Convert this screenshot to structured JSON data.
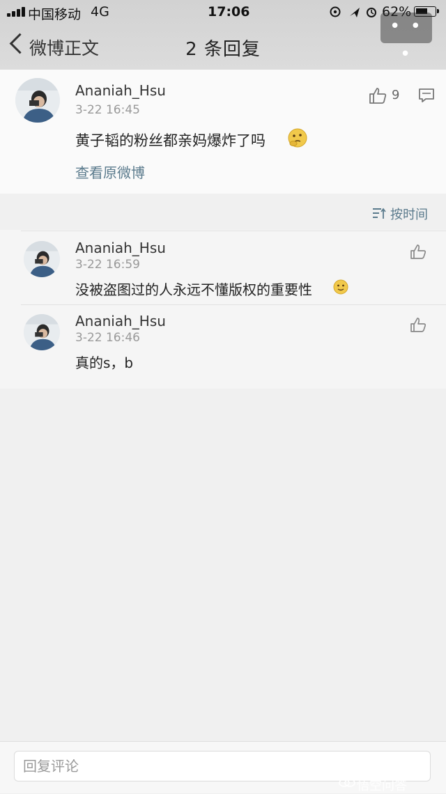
{
  "status_bar": {
    "carrier": "中国移动",
    "network": "4G",
    "time": "17:06",
    "battery_percent": "62%",
    "battery_level": 0.62
  },
  "nav": {
    "back_label": "微博正文",
    "title": "2 条回复",
    "more_label": "• • •"
  },
  "post": {
    "username": "Ananiah_Hsu",
    "timestamp": "3-22 16:45",
    "text": "黄子韬的粉丝都亲妈爆炸了吗",
    "view_original": "查看原微博",
    "like_count": "9"
  },
  "sort_label": "按时间",
  "replies": [
    {
      "username": "Ananiah_Hsu",
      "timestamp": "3-22 16:59",
      "text": "没被盗图过的人永远不懂版权的重要性"
    },
    {
      "username": "Ananiah_Hsu",
      "timestamp": "3-22 16:46",
      "text": "真的s，b"
    }
  ],
  "bottom_bar": {
    "placeholder": "回复评论"
  },
  "watermark": "悟空问答",
  "colors": {
    "link": "#5a7a8c",
    "emoji": "#f1c94b"
  }
}
